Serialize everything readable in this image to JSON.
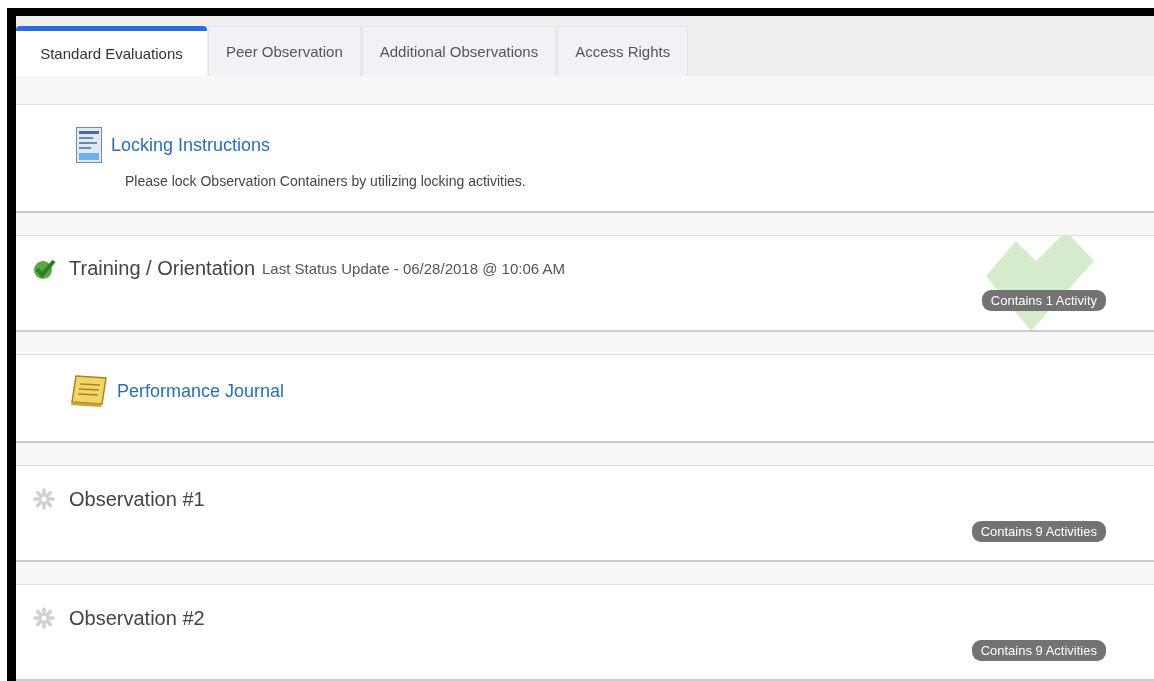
{
  "tabs": [
    {
      "label": "Standard Evaluations",
      "selected": true
    },
    {
      "label": "Peer Observation",
      "selected": false
    },
    {
      "label": "Additional Observations",
      "selected": false
    },
    {
      "label": "Access Rights",
      "selected": false
    }
  ],
  "sections": [
    {
      "kind": "instructions",
      "title": "Locking Instructions",
      "description": "Please lock Observation Containers by utilizing locking activities."
    },
    {
      "kind": "container",
      "complete": true,
      "title": "Training / Orientation",
      "status_text": "Last Status Update - 06/28/2018 @ 10:06 AM",
      "badge": "Contains 1 Activity"
    },
    {
      "kind": "journal",
      "title": "Performance Journal"
    },
    {
      "kind": "container",
      "complete": false,
      "title": "Observation #1",
      "badge": "Contains 9 Activities"
    },
    {
      "kind": "container",
      "complete": false,
      "title": "Observation #2",
      "badge": "Contains 9 Activities"
    }
  ]
}
